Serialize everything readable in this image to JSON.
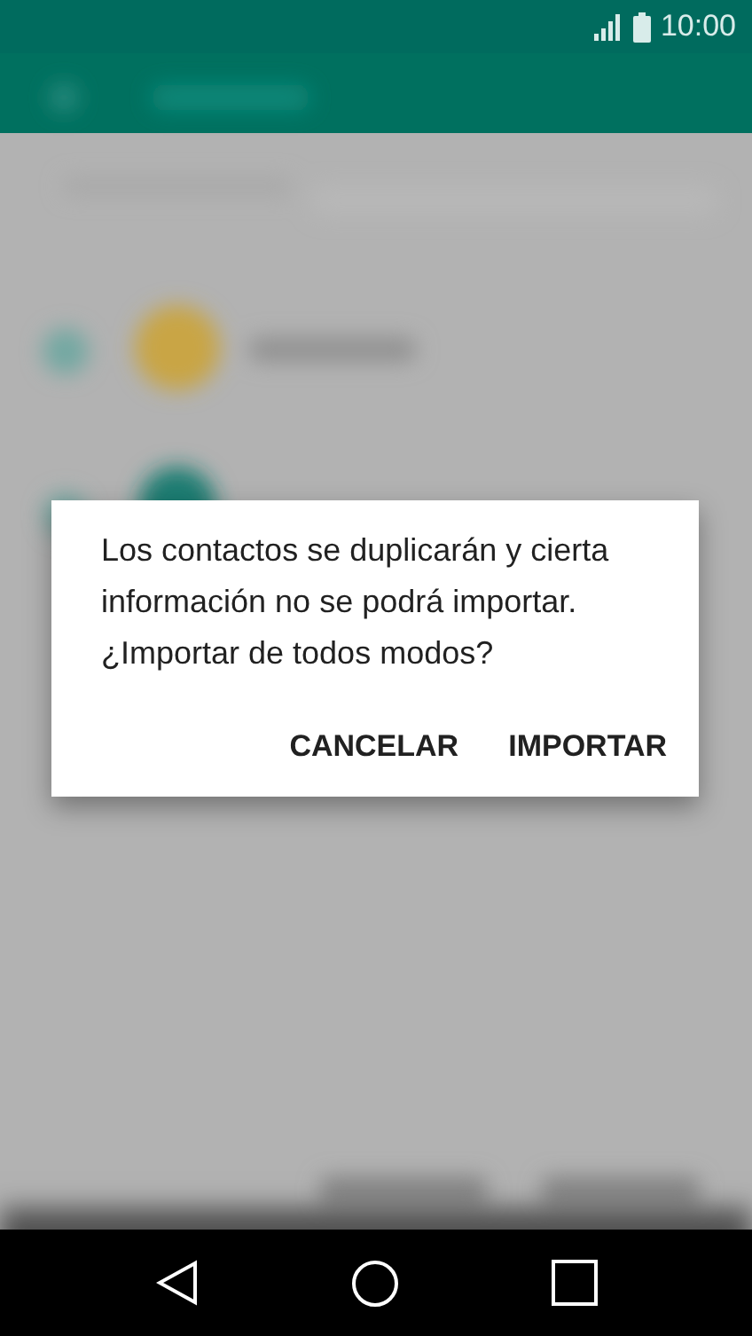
{
  "status_bar": {
    "time": "10:00"
  },
  "dialog": {
    "message": "Los contactos se duplicarán y cierta información no se podrá importar. ¿Importar de todos modos?",
    "buttons": [
      {
        "label": "CANCELAR"
      },
      {
        "label": "IMPORTAR"
      }
    ]
  }
}
